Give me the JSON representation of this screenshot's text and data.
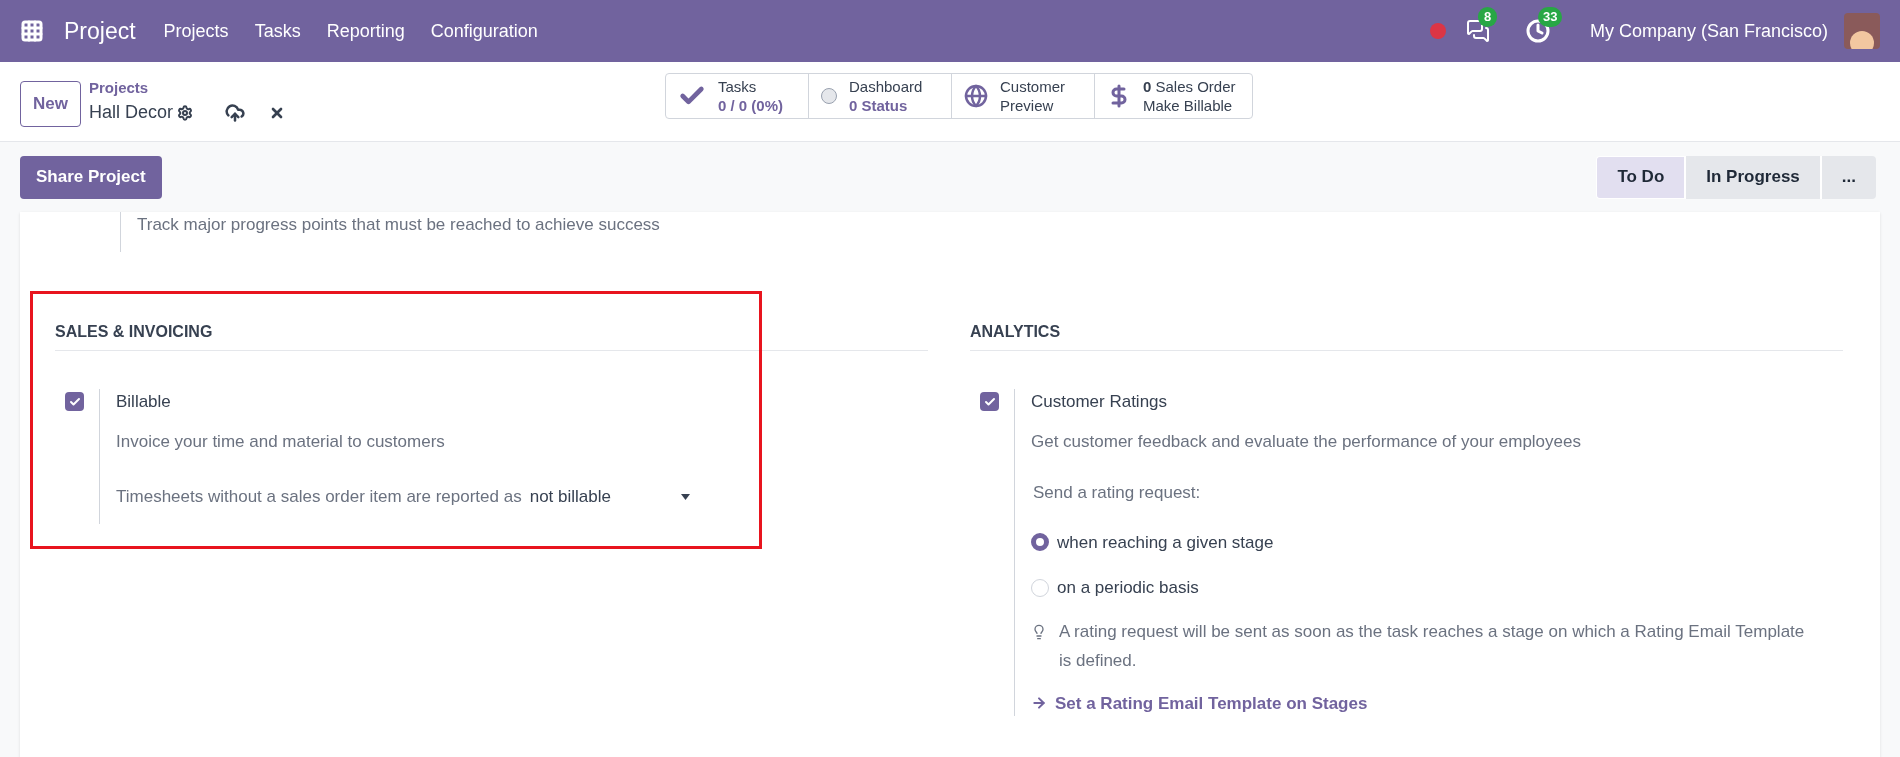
{
  "navbar": {
    "app_name": "Project",
    "menu": [
      "Projects",
      "Tasks",
      "Reporting",
      "Configuration"
    ],
    "messages_count": "8",
    "activities_count": "33",
    "company": "My Company (San Francisco)"
  },
  "control_panel": {
    "new_button": "New",
    "breadcrumb": "Projects",
    "record_name": "Hall Decor",
    "stat_buttons": [
      {
        "kind": "tasks",
        "line_1": "Tasks",
        "line_2": "0 / 0 (0%)"
      },
      {
        "kind": "dashboard",
        "line_1": "Dashboard",
        "line_2": "0 Status"
      },
      {
        "kind": "preview",
        "line_1": "Customer",
        "line_2": "Preview"
      },
      {
        "kind": "sales",
        "line_1": "**0** Sales Order",
        "line_2": "Make Billable"
      }
    ]
  },
  "action_button": "Share Project",
  "stages": [
    {
      "label": "To Do",
      "selected": true
    },
    {
      "label": "In Progress",
      "selected": false
    },
    {
      "label": "...",
      "selected": false
    }
  ],
  "previous_setting_text": "Track major progress points that must be reached to achieve success",
  "sections": [
    {
      "title": "SALES & INVOICING",
      "highlighted": true,
      "setting": {
        "label": "Billable",
        "checked": true,
        "description": "Invoice your time and material to customers",
        "field_label": "Timesheets without a sales order item are reported as",
        "field_value": "not billable"
      }
    },
    {
      "title": "ANALYTICS",
      "highlighted": false,
      "setting": {
        "label": "Customer Ratings",
        "checked": true,
        "description": "Get customer feedback and evaluate the performance of your employees",
        "prompt": "Send a rating request:",
        "options": [
          {
            "label": "when reaching a given stage",
            "selected": true
          },
          {
            "label": "on a periodic basis",
            "selected": false
          }
        ],
        "hint": "A rating request will be sent as soon as the task reaches a stage on which a Rating Email Template is defined.",
        "link": "Set a Rating Email Template on Stages"
      }
    }
  ]
}
